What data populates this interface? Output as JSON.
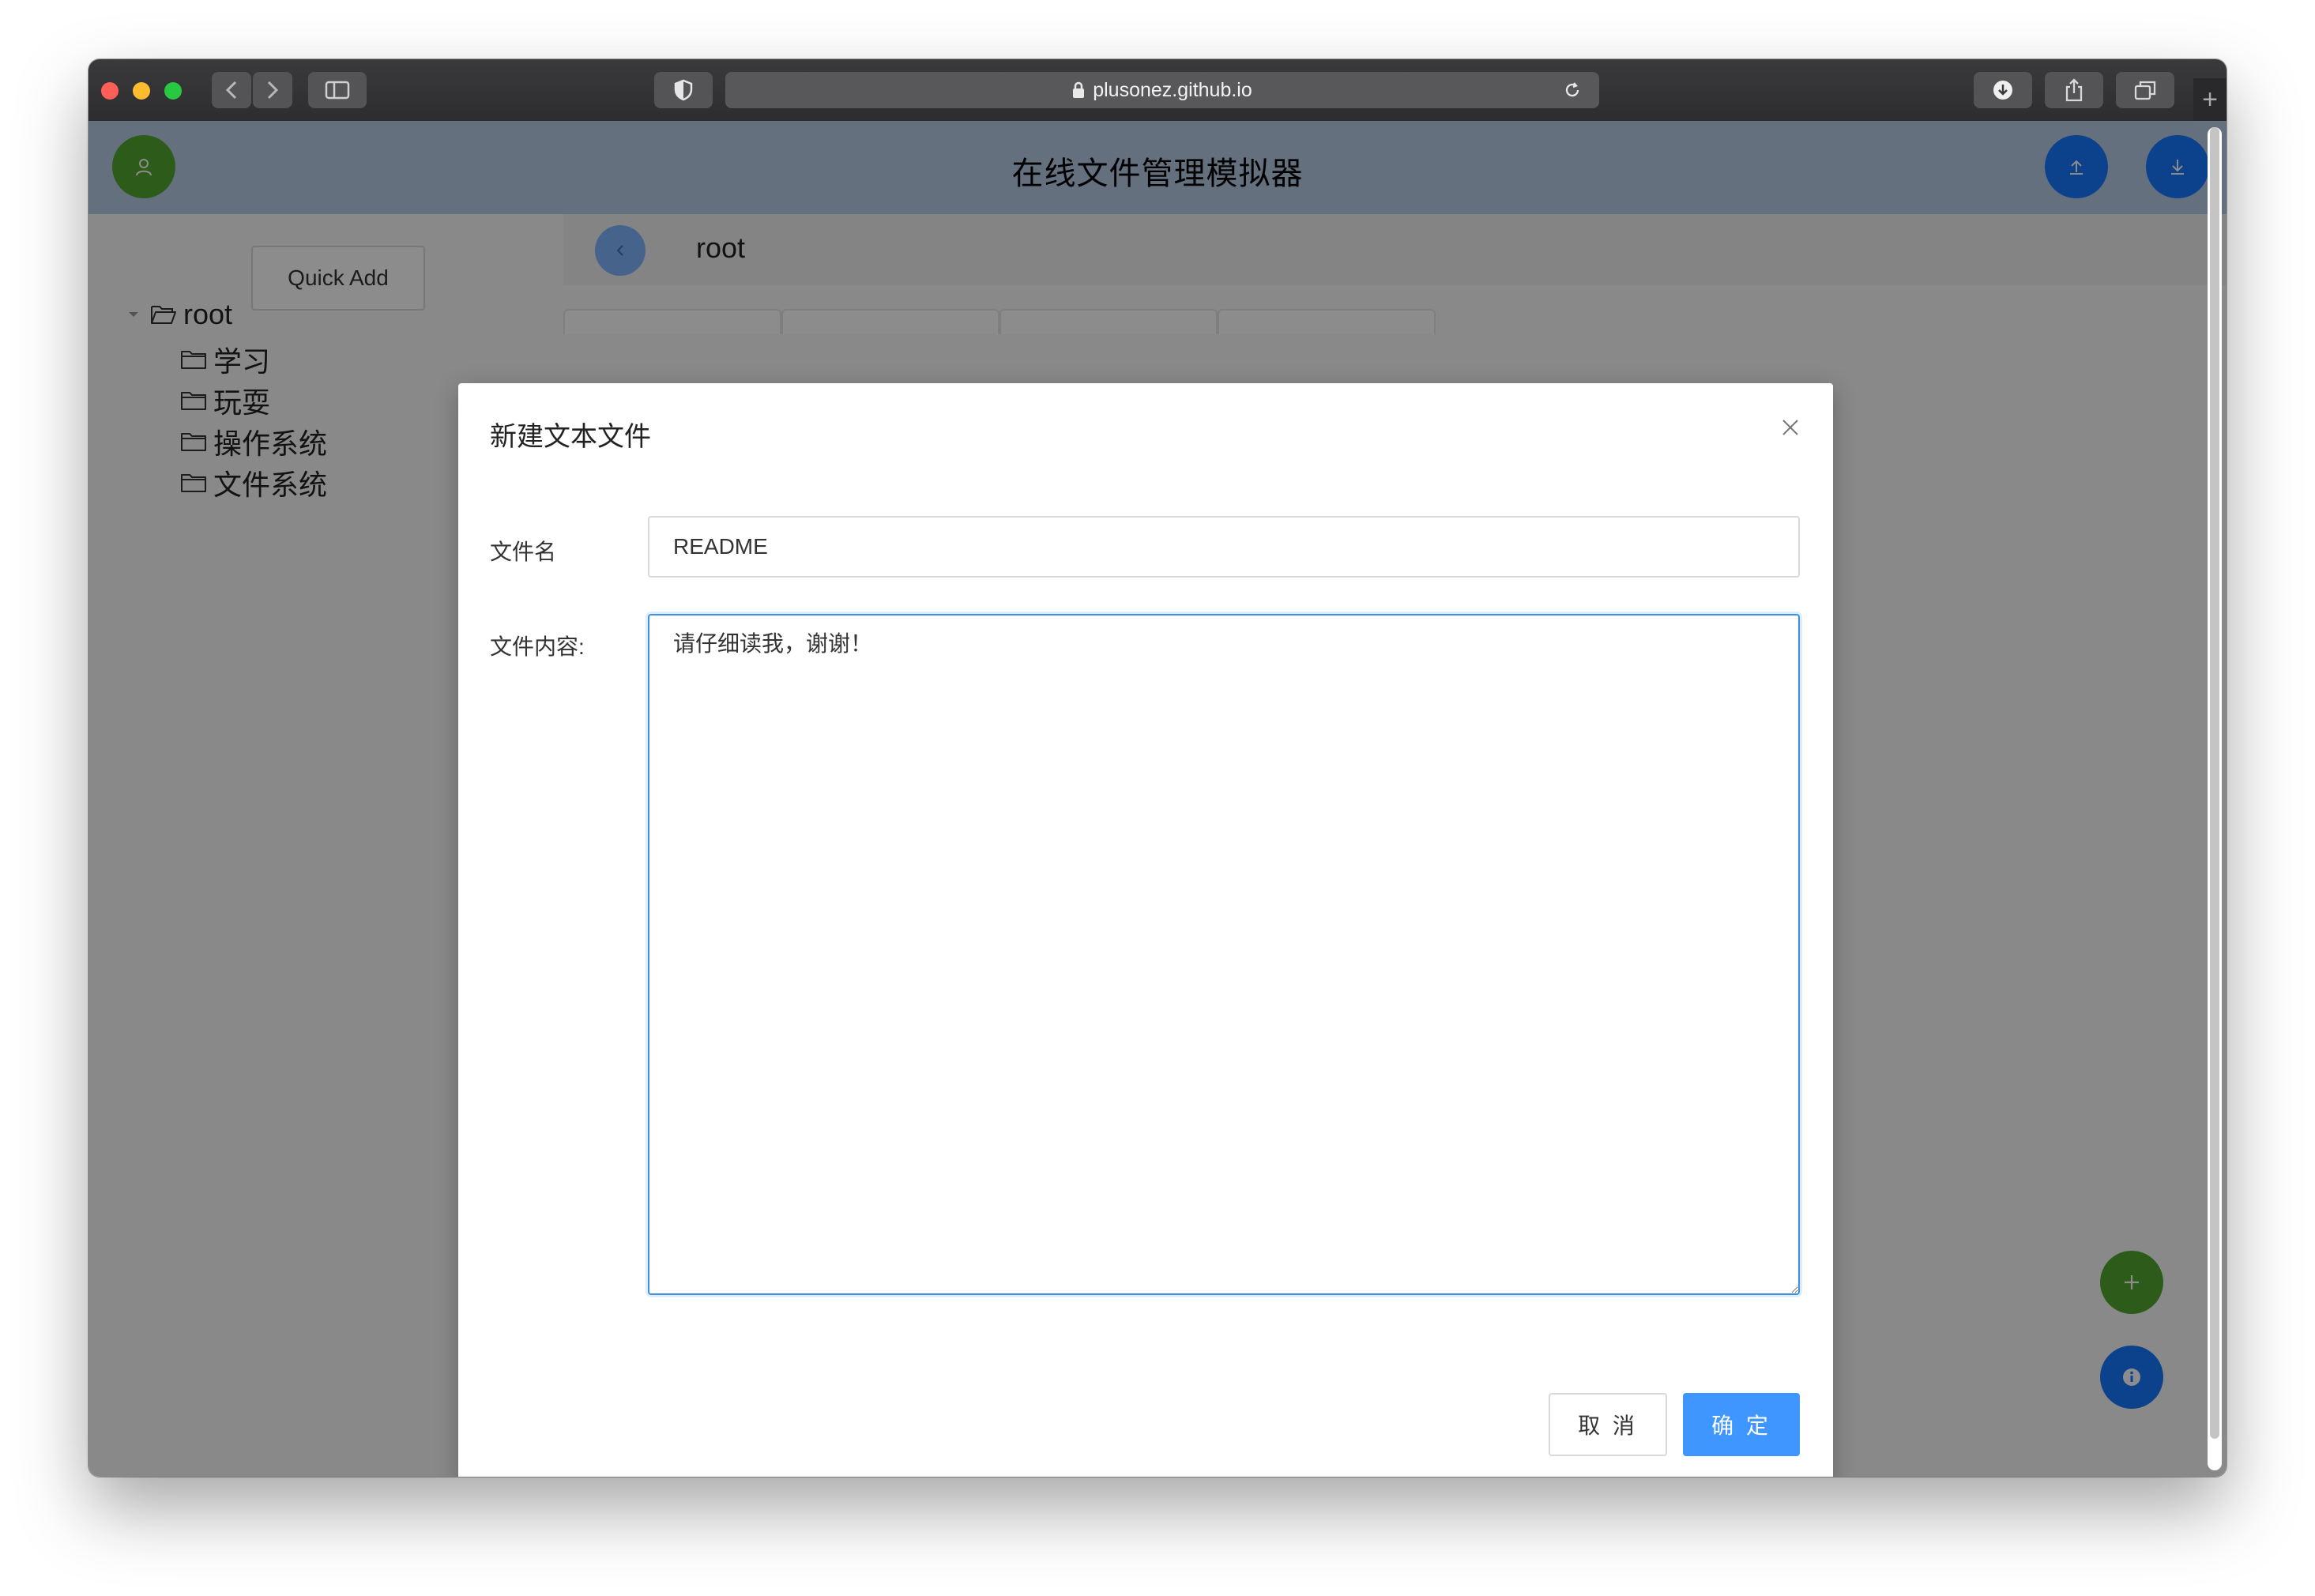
{
  "browser": {
    "url": "plusonez.github.io",
    "new_tab_label": "+"
  },
  "app": {
    "title": "在线文件管理模拟器",
    "accent_color": "#1677ff",
    "green_color": "#52a630"
  },
  "sidebar": {
    "quick_add_label": "Quick Add",
    "tree": {
      "root_label": "root",
      "children": [
        "学习",
        "玩耍",
        "操作系统",
        "文件系统"
      ]
    }
  },
  "breadcrumb": {
    "current": "root"
  },
  "dialog": {
    "title": "新建文本文件",
    "filename_label": "文件名",
    "filename_value": "README",
    "content_label": "文件内容:",
    "content_value": "请仔细读我，谢谢！",
    "cancel_label": "取 消",
    "ok_label": "确 定"
  }
}
